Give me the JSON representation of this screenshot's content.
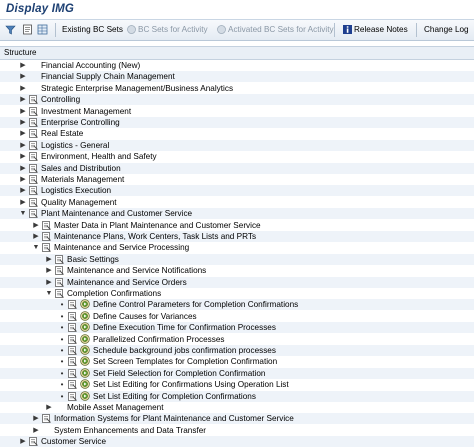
{
  "window": {
    "title": "Display IMG"
  },
  "toolbar": {
    "existing_bc_sets": "Existing BC Sets",
    "bc_sets_for_activity": "BC Sets for Activity",
    "activated_bc_sets_for_activity": "Activated BC Sets for Activity",
    "release_notes": "Release Notes",
    "change_log": "Change Log"
  },
  "structure_header": "Structure",
  "tree": [
    {
      "label": "Financial Accounting (New)",
      "level": 0,
      "expand": "collapsed",
      "doc": false
    },
    {
      "label": "Financial Supply Chain Management",
      "level": 0,
      "expand": "collapsed",
      "doc": false
    },
    {
      "label": "Strategic Enterprise Management/Business Analytics",
      "level": 0,
      "expand": "collapsed",
      "doc": false
    },
    {
      "label": "Controlling",
      "level": 0,
      "expand": "collapsed",
      "doc": true
    },
    {
      "label": "Investment Management",
      "level": 0,
      "expand": "collapsed",
      "doc": true
    },
    {
      "label": "Enterprise Controlling",
      "level": 0,
      "expand": "collapsed",
      "doc": true
    },
    {
      "label": "Real Estate",
      "level": 0,
      "expand": "collapsed",
      "doc": true
    },
    {
      "label": "Logistics - General",
      "level": 0,
      "expand": "collapsed",
      "doc": true
    },
    {
      "label": "Environment, Health and Safety",
      "level": 0,
      "expand": "collapsed",
      "doc": true
    },
    {
      "label": "Sales and Distribution",
      "level": 0,
      "expand": "collapsed",
      "doc": true
    },
    {
      "label": "Materials Management",
      "level": 0,
      "expand": "collapsed",
      "doc": true
    },
    {
      "label": "Logistics Execution",
      "level": 0,
      "expand": "collapsed",
      "doc": true
    },
    {
      "label": "Quality Management",
      "level": 0,
      "expand": "collapsed",
      "doc": true
    },
    {
      "label": "Plant Maintenance and Customer Service",
      "level": 0,
      "expand": "expanded",
      "doc": true
    },
    {
      "label": "Master Data in Plant Maintenance and Customer Service",
      "level": 1,
      "expand": "collapsed",
      "doc": true
    },
    {
      "label": "Maintenance Plans, Work Centers, Task Lists and PRTs",
      "level": 1,
      "expand": "collapsed",
      "doc": true
    },
    {
      "label": "Maintenance and Service Processing",
      "level": 1,
      "expand": "expanded",
      "doc": true
    },
    {
      "label": "Basic Settings",
      "level": 2,
      "expand": "collapsed",
      "doc": true
    },
    {
      "label": "Maintenance and Service Notifications",
      "level": 2,
      "expand": "collapsed",
      "doc": true
    },
    {
      "label": "Maintenance and Service Orders",
      "level": 2,
      "expand": "collapsed",
      "doc": true
    },
    {
      "label": "Completion Confirmations",
      "level": 2,
      "expand": "expanded",
      "doc": true
    },
    {
      "label": "Define Control Parameters for Completion Confirmations",
      "level": 3,
      "expand": "leaf",
      "doc": true,
      "activity": true
    },
    {
      "label": "Define Causes for Variances",
      "level": 3,
      "expand": "leaf",
      "doc": true,
      "activity": true
    },
    {
      "label": "Define Execution Time for Confirmation Processes",
      "level": 3,
      "expand": "leaf",
      "doc": true,
      "activity": true
    },
    {
      "label": "Parallelized Confirmation Processes",
      "level": 3,
      "expand": "leaf",
      "doc": true,
      "activity": true
    },
    {
      "label": "Schedule background jobs confirmation processes",
      "level": 3,
      "expand": "leaf",
      "doc": true,
      "activity": true
    },
    {
      "label": "Set Screen Templates for Completion Confirmation",
      "level": 3,
      "expand": "leaf",
      "doc": true,
      "activity": true
    },
    {
      "label": "Set Field Selection for Completion Confirmation",
      "level": 3,
      "expand": "leaf",
      "doc": true,
      "activity": true
    },
    {
      "label": "Set List Editing for Confirmations Using Operation List",
      "level": 3,
      "expand": "leaf",
      "doc": true,
      "activity": true
    },
    {
      "label": "Set List Editing for Completion Confirmations",
      "level": 3,
      "expand": "leaf",
      "doc": true,
      "activity": true
    },
    {
      "label": "Mobile Asset Management",
      "level": 2,
      "expand": "collapsed",
      "doc": false
    },
    {
      "label": "Information Systems for Plant Maintenance and Customer Service",
      "level": 1,
      "expand": "collapsed",
      "doc": true
    },
    {
      "label": "System Enhancements and Data Transfer",
      "level": 1,
      "expand": "collapsed",
      "doc": false
    },
    {
      "label": "Customer Service",
      "level": 0,
      "expand": "collapsed",
      "doc": true
    }
  ]
}
